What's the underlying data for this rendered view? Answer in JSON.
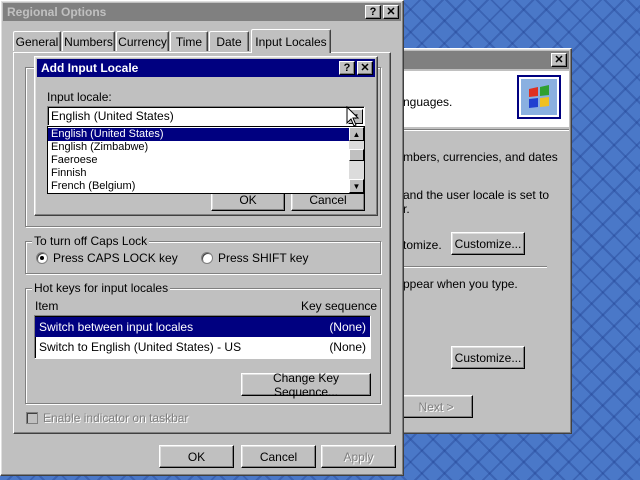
{
  "background_window": {
    "text_fragments": [
      "nguages.",
      "mbers, currencies, and dates",
      "and the user locale is set to",
      "r.",
      "tomize.",
      "ppear when you type."
    ],
    "customize1_label": "Customize...",
    "customize2_label": "Customize...",
    "next_label": "Next >"
  },
  "regional": {
    "title": "Regional Options",
    "tabs": [
      "General",
      "Numbers",
      "Currency",
      "Time",
      "Date",
      "Input Locales"
    ],
    "caps_group_label": "To turn off Caps Lock",
    "caps_options": [
      "Press CAPS LOCK key",
      "Press SHIFT key"
    ],
    "caps_selected": 0,
    "hotkeys_group_label": "Hot keys for input locales",
    "hotkeys_col_item": "Item",
    "hotkeys_col_key": "Key sequence",
    "hotkeys_rows": [
      {
        "item": "Switch between input locales",
        "key": "(None)"
      },
      {
        "item": "Switch to English (United States) - US",
        "key": "(None)"
      }
    ],
    "change_key_label": "Change Key Sequence...",
    "enable_indicator_label": "Enable indicator on taskbar",
    "ok_label": "OK",
    "cancel_label": "Cancel",
    "apply_label": "Apply"
  },
  "add_dialog": {
    "title": "Add Input Locale",
    "input_locale_label": "Input locale:",
    "selected_value": "English (United States)",
    "options": [
      "English (United States)",
      "English (Zimbabwe)",
      "Faeroese",
      "Finnish",
      "French (Belgium)"
    ],
    "highlighted_index": 0,
    "ok_label": "OK",
    "cancel_label": "Cancel"
  },
  "colors": {
    "titlebar_active": "#000080",
    "titlebar_inactive": "#808080",
    "face": "#c0c0c0"
  }
}
